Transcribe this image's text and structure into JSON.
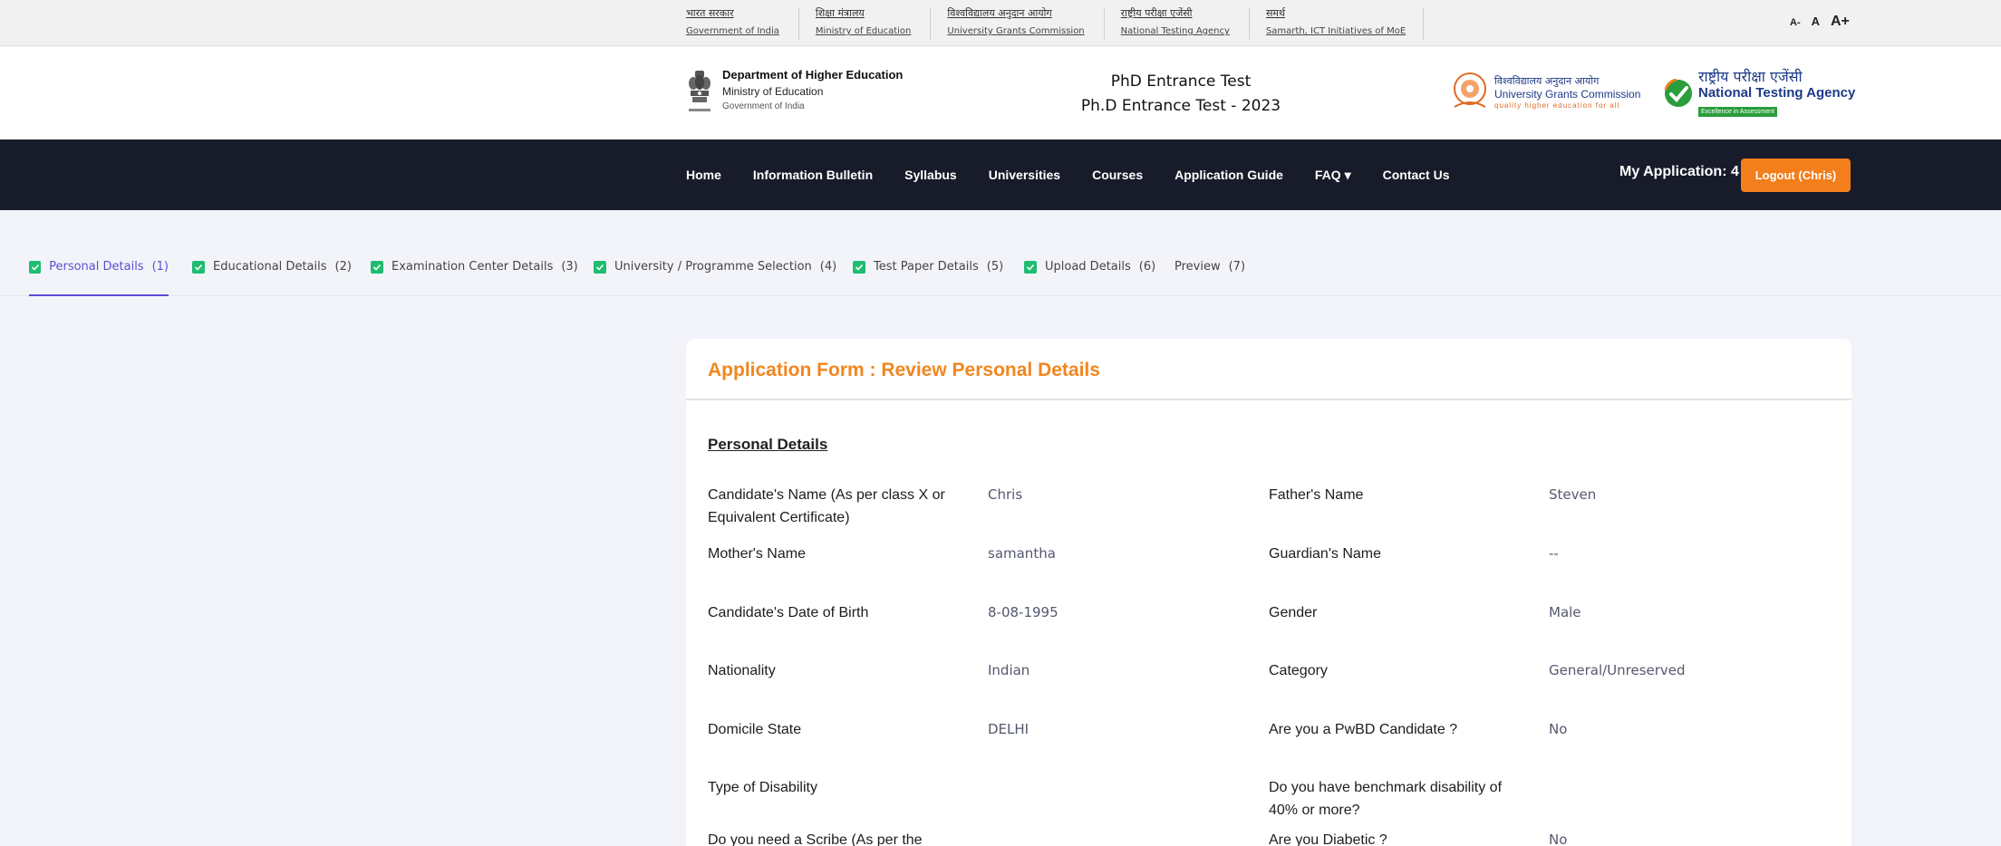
{
  "gov_links": [
    {
      "hi": "भारत सरकार",
      "en": "Government of India"
    },
    {
      "hi": "शिक्षा मंत्रालय",
      "en": "Ministry of Education"
    },
    {
      "hi": "विश्वविद्यालय अनुदान आयोग",
      "en": "University Grants Commission"
    },
    {
      "hi": "राष्ट्रीय परीक्षा एजेंसी",
      "en": "National Testing Agency"
    },
    {
      "hi": "समर्थ",
      "en": "Samarth, ICT Initiatives of MoE"
    }
  ],
  "font_controls": {
    "small": "A-",
    "normal": "A",
    "large": "A+"
  },
  "header": {
    "dept_line1": "Department of Higher Education",
    "dept_line2": "Ministry of Education",
    "dept_line3": "Government of India",
    "title1": "PhD Entrance Test",
    "title2": "Ph.D Entrance Test - 2023",
    "ugc_hi": "विश्वविद्यालय अनुदान आयोग",
    "ugc_en": "University Grants Commission",
    "ugc_tag": "quality higher education for all",
    "nta_hi": "राष्ट्रीय परीक्षा एजेंसी",
    "nta_en": "National Testing Agency",
    "nta_tag": "Excellence in Assessment"
  },
  "nav": {
    "items": [
      "Home",
      "Information Bulletin",
      "Syllabus",
      "Universities",
      "Courses",
      "Application Guide",
      "FAQ ▾",
      "Contact Us"
    ],
    "my_application": "My Application: 4",
    "logout": "Logout (Chris)"
  },
  "steps": [
    {
      "label": "Personal Details",
      "num": "(1)"
    },
    {
      "label": "Educational Details",
      "num": "(2)"
    },
    {
      "label": "Examination Center Details",
      "num": "(3)"
    },
    {
      "label": "University / Programme Selection",
      "num": "(4)"
    },
    {
      "label": "Test Paper Details",
      "num": "(5)"
    },
    {
      "label": "Upload Details",
      "num": "(6)"
    },
    {
      "label": "Preview",
      "num": "(7)"
    }
  ],
  "form": {
    "title": "Application Form : Review Personal Details",
    "section": "Personal Details",
    "fields": [
      {
        "label": "Candidate's Name (As per class X or Equivalent Certificate)",
        "value": "Chris"
      },
      {
        "label": "Father's Name",
        "value": "Steven"
      },
      {
        "label": "Mother's Name",
        "value": "samantha"
      },
      {
        "label": "Guardian's Name",
        "value": "--"
      },
      {
        "label": "Candidate's Date of Birth",
        "value": "8-08-1995"
      },
      {
        "label": "Gender",
        "value": "Male"
      },
      {
        "label": "Nationality",
        "value": "Indian"
      },
      {
        "label": "Category",
        "value": "General/Unreserved"
      },
      {
        "label": "Domicile State",
        "value": "DELHI"
      },
      {
        "label": "Are you a PwBD Candidate ?",
        "value": "No"
      },
      {
        "label": "Type of Disability",
        "value": ""
      },
      {
        "label": "Do you have benchmark disability of 40% or more?",
        "value": ""
      },
      {
        "label": "Do you need a Scribe (As per the",
        "value": ""
      },
      {
        "label": "Are you Diabetic ?",
        "value": "No"
      }
    ]
  },
  "colors": {
    "accent": "#f2861e",
    "nav_bg": "#181b2a",
    "active_tab": "#5a4fd1",
    "check": "#1fbd6f"
  }
}
